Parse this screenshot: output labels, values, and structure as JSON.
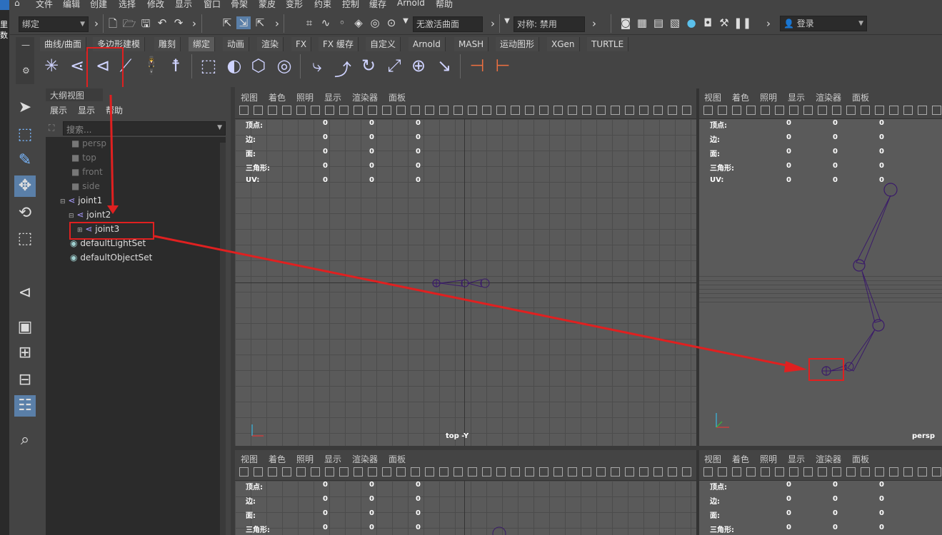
{
  "menu": [
    "文件",
    "编辑",
    "创建",
    "选择",
    "修改",
    "显示",
    "窗口",
    "骨架",
    "蒙皮",
    "变形",
    "约束",
    "控制",
    "缓存",
    "Arnold",
    "帮助"
  ],
  "left_edge_chars": [
    "里",
    "数"
  ],
  "status": {
    "mode_dropdown": "绑定",
    "surface_field": "无激活曲面",
    "symmetry": "对称: 禁用",
    "login": "登录"
  },
  "shelf_tabs": [
    "曲线/曲面",
    "多边形建模",
    "雕刻",
    "绑定",
    "动画",
    "渲染",
    "FX",
    "FX 缓存",
    "自定义",
    "Arnold",
    "MASH",
    "运动图形",
    "XGen",
    "TURTLE"
  ],
  "shelf_active_tab": "绑定",
  "outliner": {
    "title": "大纲视图",
    "menu": [
      "展示",
      "显示",
      "帮助"
    ],
    "search_placeholder": "搜索...",
    "items": [
      "persp",
      "top",
      "front",
      "side",
      "joint1",
      "joint2",
      "joint3",
      "defaultLightSet",
      "defaultObjectSet"
    ]
  },
  "viewport_menu": [
    "视图",
    "着色",
    "照明",
    "显示",
    "渲染器",
    "面板"
  ],
  "hud": {
    "labels": [
      "顶点:",
      "边:",
      "面:",
      "三角形:",
      "UV:"
    ],
    "values": [
      "0",
      "0",
      "0"
    ]
  },
  "viewports": {
    "top_left_label": "top -Y",
    "top_right_label": "persp"
  },
  "colors": {
    "annotation_red": "#e02020",
    "joint_purple": "#3a1a6a"
  }
}
